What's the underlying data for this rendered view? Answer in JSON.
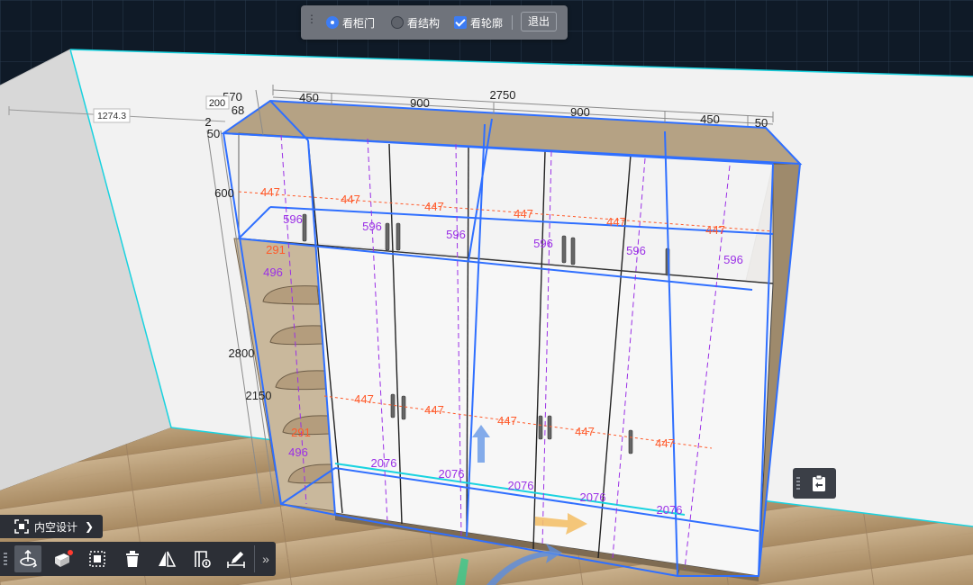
{
  "top_toolbar": {
    "options": [
      {
        "label": "看柜门",
        "type": "radio",
        "checked": true
      },
      {
        "label": "看结构",
        "type": "radio",
        "checked": false
      },
      {
        "label": "看轮廓",
        "type": "checkbox",
        "checked": true
      }
    ],
    "exit_label": "退出"
  },
  "dimensions": {
    "top_total": "2750",
    "top_segments": [
      "450",
      "900",
      "900",
      "450"
    ],
    "top_right_gap": "50",
    "depth_top": "570",
    "depth_small": "200",
    "depth_68": "68",
    "depth_2": "2",
    "depth_50": "50",
    "wall_offset": "1274.3",
    "height_total": "2800",
    "height_lower": "2150",
    "height_upper": "600",
    "interior_width": "447",
    "upper_depth": "596",
    "shelf_291": "291",
    "shelf_496": "496",
    "door_height": "2076"
  },
  "mode_chip": {
    "label": "内空设计"
  },
  "bottom_toolbar": {
    "tools": [
      "move-rotate-tool",
      "material-tool",
      "select-box-tool",
      "delete-tool",
      "mirror-tool",
      "replace-tool",
      "measure-tool"
    ],
    "more": "»"
  },
  "colors": {
    "accent": "#3d7cf3",
    "outline": "#2f6fff",
    "dim_red": "#ff5a2a",
    "dim_purple": "#9b30e6",
    "wall_line": "#19d3e0"
  }
}
